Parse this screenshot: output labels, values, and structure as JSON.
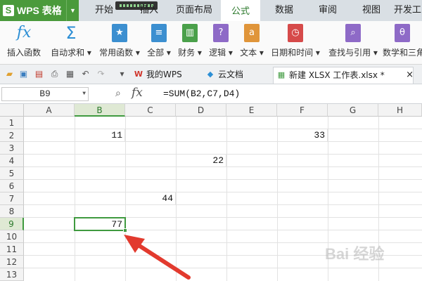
{
  "app": {
    "title": "WPS 表格"
  },
  "menu": [
    {
      "label": "开始"
    },
    {
      "label": "插入"
    },
    {
      "label": "页面布局"
    },
    {
      "label": "公式"
    },
    {
      "label": "数据"
    },
    {
      "label": "审阅"
    },
    {
      "label": "视图"
    },
    {
      "label": "开发工"
    }
  ],
  "active_menu": "公式",
  "ribbon": [
    {
      "label": "插入函数",
      "icon": "fx-icon"
    },
    {
      "label": "自动求和",
      "icon": "sum-icon"
    },
    {
      "label": "常用函数",
      "icon": "star-book-icon"
    },
    {
      "label": "全部",
      "icon": "book-icon"
    },
    {
      "label": "财务",
      "icon": "finance-book-icon"
    },
    {
      "label": "逻辑",
      "icon": "question-book-icon"
    },
    {
      "label": "文本",
      "icon": "text-book-icon"
    },
    {
      "label": "日期和时间",
      "icon": "clock-book-icon"
    },
    {
      "label": "查找与引用",
      "icon": "search-book-icon"
    },
    {
      "label": "数学和三角",
      "icon": "theta-book-icon"
    }
  ],
  "tabs": [
    {
      "label": "我的WPS",
      "icon": "wps-icon"
    },
    {
      "label": "云文档",
      "icon": "cloud-cube-icon"
    },
    {
      "label": "新建 XLSX 工作表.xlsx *",
      "icon": "spreadsheet-icon"
    }
  ],
  "formula_bar": {
    "name_box": "B9",
    "fx": "fx",
    "formula": "=SUM(B2,C7,D4)"
  },
  "columns": [
    "A",
    "B",
    "C",
    "D",
    "E",
    "F",
    "G",
    "H"
  ],
  "rows": [
    "1",
    "2",
    "3",
    "4",
    "5",
    "6",
    "7",
    "8",
    "9",
    "10",
    "11",
    "12",
    "13"
  ],
  "selected_cell": "B9",
  "cells": [
    {
      "ref": "B2",
      "value": "11"
    },
    {
      "ref": "F2",
      "value": "33"
    },
    {
      "ref": "D4",
      "value": "22"
    },
    {
      "ref": "C7",
      "value": "44"
    },
    {
      "ref": "B9",
      "value": "77"
    }
  ],
  "colors": {
    "brand": "#4a9a3b",
    "accent_red": "#e23a2e",
    "selection": "#3f9a3f"
  },
  "watermark": "Bai 经验"
}
